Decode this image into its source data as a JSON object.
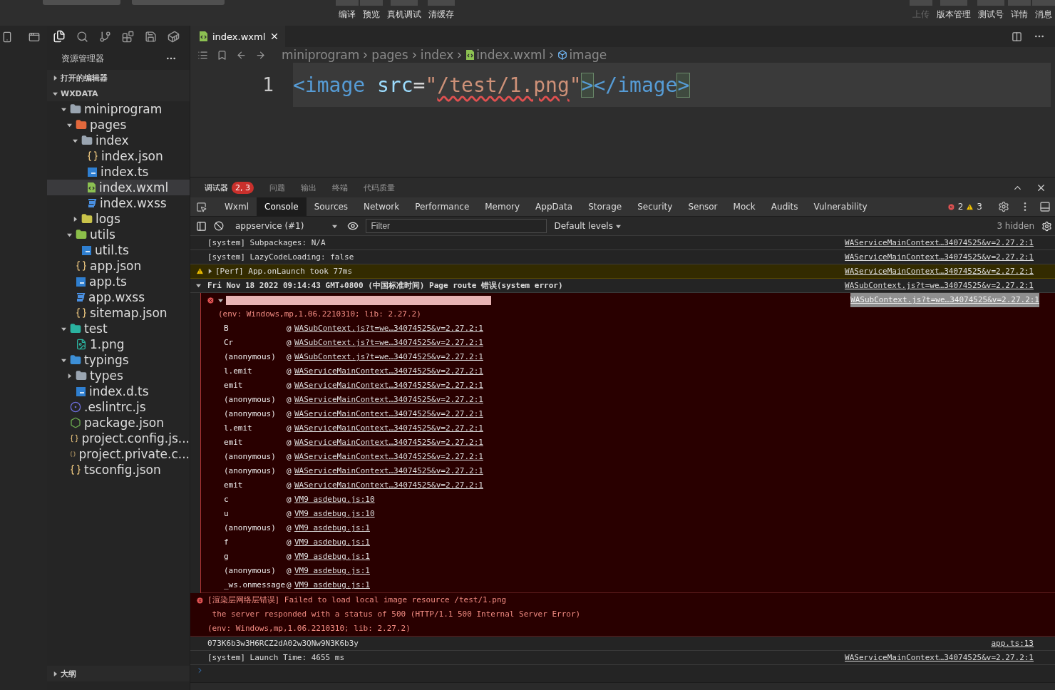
{
  "toolbar": {
    "dropdowns": [
      {
        "kind": "mode"
      },
      {
        "kind": "compile"
      }
    ],
    "left_buttons": [
      {
        "label": "编译",
        "disabled": false
      },
      {
        "label": "预览",
        "disabled": false
      },
      {
        "label": "真机调试",
        "disabled": false
      },
      {
        "label": "清缓存",
        "disabled": false
      }
    ],
    "right_buttons": [
      {
        "label": "上传",
        "disabled": true
      },
      {
        "label": "版本管理",
        "disabled": false
      },
      {
        "label": "测试号",
        "disabled": false
      },
      {
        "label": "详情",
        "disabled": false
      },
      {
        "label": "消息",
        "disabled": false
      }
    ]
  },
  "sidebar": {
    "title": "资源管理器",
    "sections": [
      {
        "label": "打开的编辑器",
        "expanded": false
      },
      {
        "label": "WXDATA",
        "expanded": true
      }
    ],
    "tree": [
      {
        "label": "miniprogram",
        "kind": "folder",
        "expanded": true,
        "selected": false,
        "children": [
          {
            "label": "pages",
            "kind": "folder-pages",
            "expanded": true,
            "selected": false,
            "children": [
              {
                "label": "index",
                "kind": "folder",
                "expanded": true,
                "selected": false,
                "children": [
                  {
                    "label": "index.json",
                    "kind": "json",
                    "selected": false
                  },
                  {
                    "label": "index.ts",
                    "kind": "ts",
                    "selected": false
                  },
                  {
                    "label": "index.wxml",
                    "kind": "wxml",
                    "selected": true
                  },
                  {
                    "label": "index.wxss",
                    "kind": "wxss",
                    "selected": false
                  }
                ]
              },
              {
                "label": "logs",
                "kind": "folder-logs",
                "expanded": false,
                "selected": false
              }
            ]
          },
          {
            "label": "utils",
            "kind": "folder-utils",
            "expanded": true,
            "selected": false,
            "children": [
              {
                "label": "util.ts",
                "kind": "ts",
                "selected": false
              }
            ]
          },
          {
            "label": "app.json",
            "kind": "json",
            "selected": false
          },
          {
            "label": "app.ts",
            "kind": "ts",
            "selected": false
          },
          {
            "label": "app.wxss",
            "kind": "wxss",
            "selected": false
          },
          {
            "label": "sitemap.json",
            "kind": "json",
            "selected": false
          }
        ]
      },
      {
        "label": "test",
        "kind": "folder-test",
        "expanded": true,
        "selected": false,
        "children": [
          {
            "label": "1.png",
            "kind": "png",
            "selected": false
          }
        ]
      },
      {
        "label": "typings",
        "kind": "folder-typings",
        "expanded": true,
        "selected": false,
        "children": [
          {
            "label": "types",
            "kind": "folder",
            "expanded": false,
            "selected": false
          },
          {
            "label": "index.d.ts",
            "kind": "ts",
            "selected": false
          }
        ]
      },
      {
        "label": ".eslintrc.js",
        "kind": "eslint",
        "selected": false
      },
      {
        "label": "package.json",
        "kind": "npm",
        "selected": false
      },
      {
        "label": "project.config.js...",
        "kind": "json",
        "selected": false
      },
      {
        "label": "project.private.c...",
        "kind": "json",
        "selected": false
      },
      {
        "label": "tsconfig.json",
        "kind": "json",
        "selected": false
      }
    ],
    "outline": {
      "label": "大纲",
      "expanded": false
    }
  },
  "editor": {
    "tab": {
      "label": "index.wxml"
    },
    "breadcrumb": [
      "miniprogram",
      "pages",
      "index",
      "index.wxml",
      "image"
    ],
    "lines": [
      {
        "number": "1",
        "tokens": [
          {
            "text": "<image",
            "kind": "tag",
            "matched": false
          },
          {
            "text": " src",
            "kind": "attr",
            "matched": false
          },
          {
            "text": "=",
            "kind": "plain",
            "matched": false
          },
          {
            "text": "\"",
            "kind": "string",
            "matched": false
          },
          {
            "text": "/test/1.png",
            "kind": "error-string",
            "matched": false
          },
          {
            "text": "\"",
            "kind": "string",
            "matched": false
          },
          {
            "text": ">",
            "kind": "tag",
            "matched": true
          },
          {
            "text": "</image",
            "kind": "tag",
            "matched": false
          },
          {
            "text": ">",
            "kind": "tag",
            "matched": true
          }
        ]
      }
    ]
  },
  "debug": {
    "tabs": [
      {
        "label": "调试器",
        "badge": "2, 3",
        "selected": true
      },
      {
        "label": "问题",
        "selected": false
      },
      {
        "label": "输出",
        "selected": false
      },
      {
        "label": "终端",
        "selected": false
      },
      {
        "label": "代码质量",
        "selected": false
      }
    ],
    "devtools_tabs": [
      {
        "label": "Wxml",
        "selected": false
      },
      {
        "label": "Console",
        "selected": true
      },
      {
        "label": "Sources",
        "selected": false
      },
      {
        "label": "Network",
        "selected": false
      },
      {
        "label": "Performance",
        "selected": false
      },
      {
        "label": "Memory",
        "selected": false
      },
      {
        "label": "AppData",
        "selected": false
      },
      {
        "label": "Storage",
        "selected": false
      },
      {
        "label": "Security",
        "selected": false
      },
      {
        "label": "Sensor",
        "selected": false
      },
      {
        "label": "Mock",
        "selected": false
      },
      {
        "label": "Audits",
        "selected": false
      },
      {
        "label": "Vulnerability",
        "selected": false
      }
    ],
    "error_count": "2",
    "warning_count": "3",
    "context": "appservice (#1)",
    "filter_placeholder": "Filter",
    "levels": "Default levels",
    "hidden": "3 hidden",
    "console": [
      {
        "kind": "log",
        "text": "[system] Subpackages: N/A",
        "link": "WAServiceMainContext…34074525&v=2.27.2:1"
      },
      {
        "kind": "log",
        "text": "[system] LazyCodeLoading: false",
        "link": "WAServiceMainContext…34074525&v=2.27.2:1"
      },
      {
        "kind": "warning",
        "text": "[Perf] App.onLaunch took 77ms",
        "expanded": false,
        "link": "WAServiceMainContext…34074525&v=2.27.2:1"
      },
      {
        "kind": "group",
        "text": "Fri Nov 18 2022 09:14:43 GMT+0800 (中国标准时间) Page route 错误(system error)",
        "expanded": true,
        "link": "WASubContext.js?t=we…34074525&v=2.27.2:1",
        "children": [
          {
            "kind": "error",
            "selected": true,
            "expanded": true,
            "lines": [
              "(env: Windows,mp,1.06.2210310; lib: 2.27.2)"
            ],
            "link": "WASubContext.js?t=we…34074525&v=2.27.2:1",
            "stack": [
              {
                "fn": "B",
                "at": "@",
                "link": "WASubContext.js?t=we…34074525&v=2.27.2:1"
              },
              {
                "fn": "Cr",
                "at": "@",
                "link": "WASubContext.js?t=we…34074525&v=2.27.2:1"
              },
              {
                "fn": "(anonymous)",
                "at": "@",
                "link": "WASubContext.js?t=we…34074525&v=2.27.2:1"
              },
              {
                "fn": "l.emit",
                "at": "@",
                "link": "WAServiceMainContext…34074525&v=2.27.2:1"
              },
              {
                "fn": "emit",
                "at": "@",
                "link": "WAServiceMainContext…34074525&v=2.27.2:1"
              },
              {
                "fn": "(anonymous)",
                "at": "@",
                "link": "WAServiceMainContext…34074525&v=2.27.2:1"
              },
              {
                "fn": "(anonymous)",
                "at": "@",
                "link": "WAServiceMainContext…34074525&v=2.27.2:1"
              },
              {
                "fn": "l.emit",
                "at": "@",
                "link": "WAServiceMainContext…34074525&v=2.27.2:1"
              },
              {
                "fn": "emit",
                "at": "@",
                "link": "WAServiceMainContext…34074525&v=2.27.2:1"
              },
              {
                "fn": "(anonymous)",
                "at": "@",
                "link": "WAServiceMainContext…34074525&v=2.27.2:1"
              },
              {
                "fn": "(anonymous)",
                "at": "@",
                "link": "WAServiceMainContext…34074525&v=2.27.2:1"
              },
              {
                "fn": "emit",
                "at": "@",
                "link": "WAServiceMainContext…34074525&v=2.27.2:1"
              },
              {
                "fn": "c",
                "at": "@",
                "link": "VM9 asdebug.js:10"
              },
              {
                "fn": "u",
                "at": "@",
                "link": "VM9 asdebug.js:10"
              },
              {
                "fn": "(anonymous)",
                "at": "@",
                "link": "VM9 asdebug.js:1"
              },
              {
                "fn": "f",
                "at": "@",
                "link": "VM9 asdebug.js:1"
              },
              {
                "fn": "g",
                "at": "@",
                "link": "VM9 asdebug.js:1"
              },
              {
                "fn": "(anonymous)",
                "at": "@",
                "link": "VM9 asdebug.js:1"
              },
              {
                "fn": "_ws.onmessage",
                "at": "@",
                "link": "VM9 asdebug.js:1"
              }
            ]
          }
        ]
      },
      {
        "kind": "error",
        "selected": false,
        "lines": [
          "[渲染层网络层错误] Failed to load local image resource /test/1.png",
          " the server responded with a status of 500 (HTTP/1.1 500 Internal Server Error)",
          "(env: Windows,mp,1.06.2210310; lib: 2.27.2)"
        ]
      },
      {
        "kind": "log",
        "text": "073K6b3w3H6RCZ2dA02w3QNw9N3K6b3y",
        "link": "app.ts:13"
      },
      {
        "kind": "log",
        "text": "[system] Launch Time: 4655 ms",
        "link": "WAServiceMainContext…34074525&v=2.27.2:1"
      }
    ]
  }
}
